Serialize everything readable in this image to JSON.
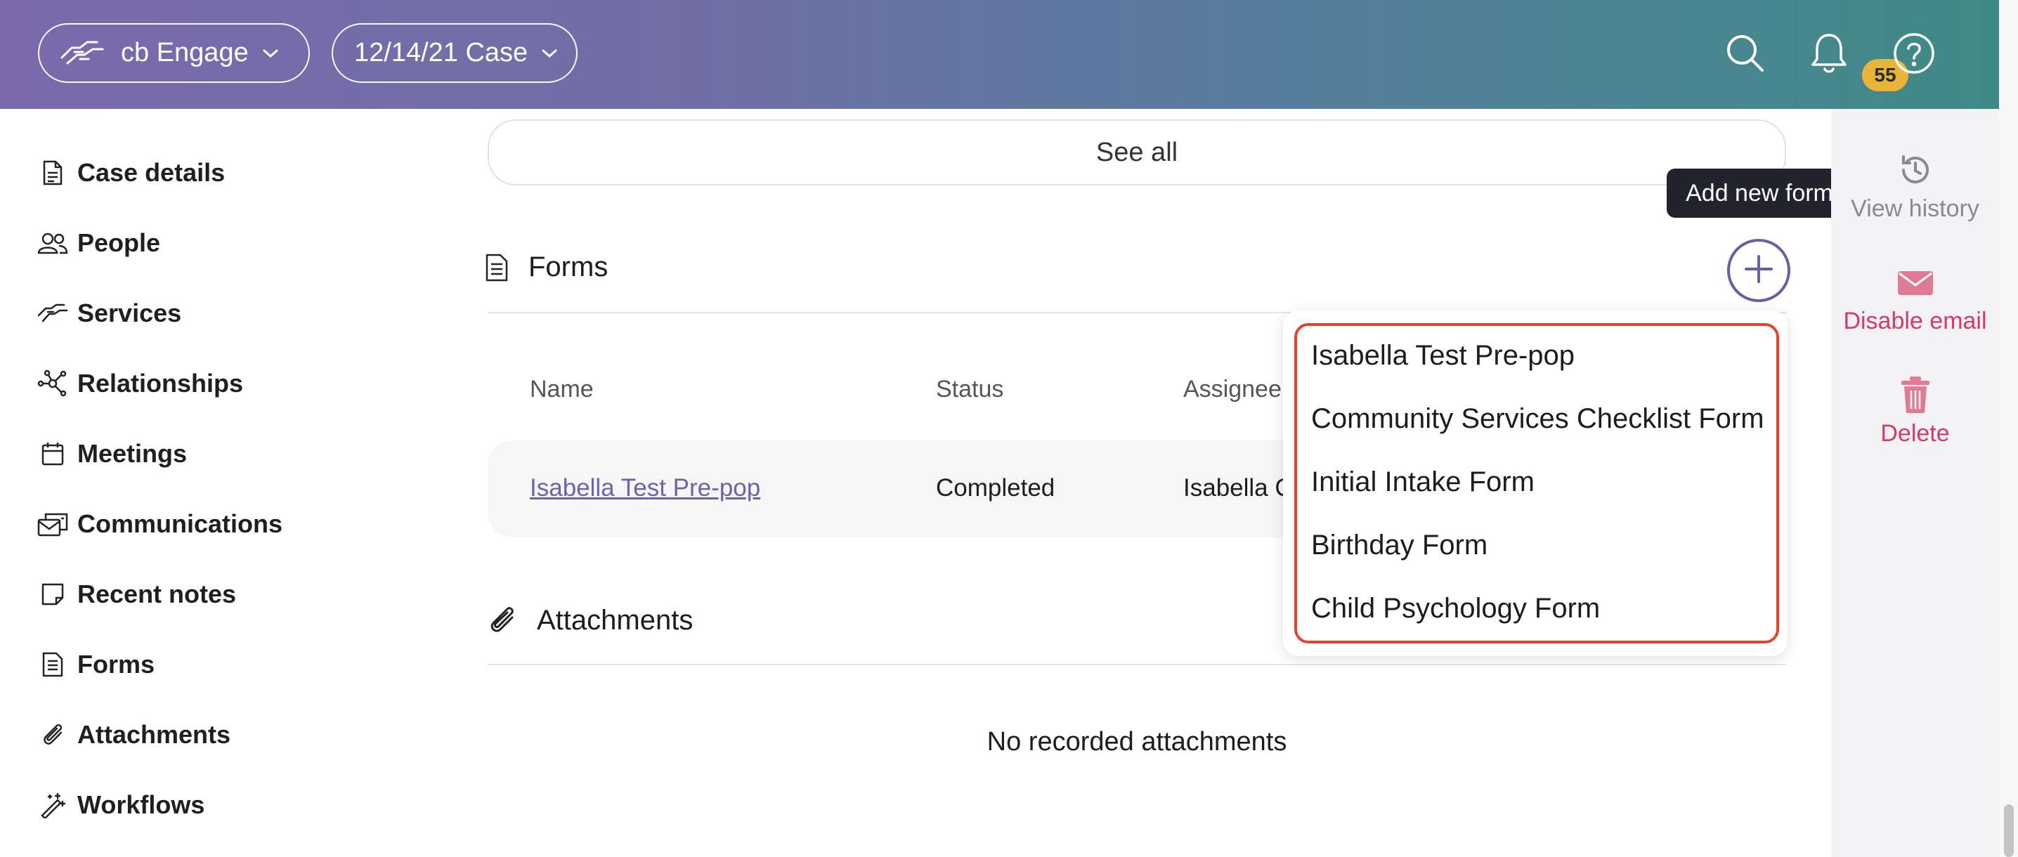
{
  "header": {
    "app_switcher_label": "cb Engage",
    "case_switcher_label": "12/14/21 Case",
    "notification_count": "55"
  },
  "sidebar": {
    "items": [
      {
        "label": "Case details",
        "icon": "document-icon"
      },
      {
        "label": "People",
        "icon": "people-icon"
      },
      {
        "label": "Services",
        "icon": "handshake-icon"
      },
      {
        "label": "Relationships",
        "icon": "network-icon"
      },
      {
        "label": "Meetings",
        "icon": "calendar-icon"
      },
      {
        "label": "Communications",
        "icon": "mail-icon"
      },
      {
        "label": "Recent notes",
        "icon": "note-icon"
      },
      {
        "label": "Forms",
        "icon": "form-icon"
      },
      {
        "label": "Attachments",
        "icon": "paperclip-icon"
      },
      {
        "label": "Workflows",
        "icon": "magic-wand-icon"
      }
    ]
  },
  "main": {
    "see_all_label": "See all",
    "forms_section": {
      "title": "Forms",
      "add_tooltip": "Add new form",
      "columns": [
        "Name",
        "Status",
        "Assignee"
      ],
      "rows": [
        {
          "name": "Isabella Test Pre-pop",
          "status": "Completed",
          "assignee": "Isabella C"
        }
      ]
    },
    "attachments_section": {
      "title": "Attachments",
      "empty_text": "No recorded attachments"
    }
  },
  "dropdown": {
    "items": [
      "Isabella Test Pre-pop",
      "Community Services Checklist Form",
      "Initial Intake Form",
      "Birthday Form",
      "Child Psychology Form"
    ]
  },
  "rail": {
    "view_history": "View history",
    "disable_email": "Disable email",
    "delete": "Delete"
  },
  "colors": {
    "accent": "#6b5fa4",
    "danger": "#d6386a",
    "highlight_border": "#e0452f",
    "badge": "#e9b43a"
  }
}
